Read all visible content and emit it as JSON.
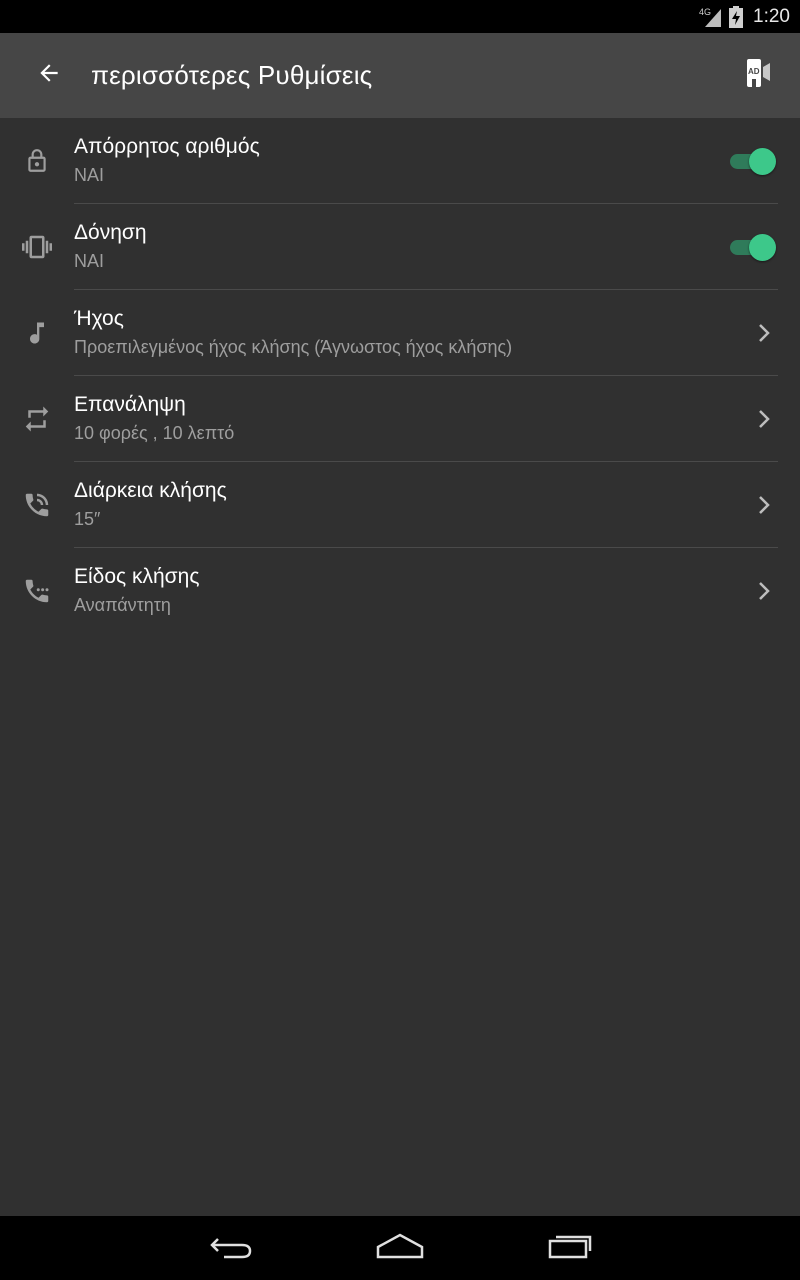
{
  "status_bar": {
    "network": "4G",
    "time": "1:20"
  },
  "app_bar": {
    "title": "περισσότερες Ρυθμίσεις",
    "back_icon": "arrow-left-icon",
    "action_icon": "ad-block-icon"
  },
  "colors": {
    "accent": "#3dc88a",
    "toggle_track": "#2f7b5a",
    "app_bar": "#464646",
    "background": "#303030"
  },
  "settings": [
    {
      "title": "Απόρρητος αριθμός",
      "subtitle": "ΝΑΙ",
      "icon": "lock-icon",
      "control": "toggle",
      "checked": true
    },
    {
      "title": "Δόνηση",
      "subtitle": "ΝΑΙ",
      "icon": "vibrate-icon",
      "control": "toggle",
      "checked": true
    },
    {
      "title": "Ήχος",
      "subtitle": "Προεπιλεγμένος ήχος κλήσης (Άγνωστος ήχος κλήσης)",
      "icon": "music-note-icon",
      "control": "chevron"
    },
    {
      "title": "Επανάληψη",
      "subtitle": "10 φορές , 10 λεπτό",
      "icon": "repeat-icon",
      "control": "chevron"
    },
    {
      "title": "Διάρκεια κλήσης",
      "subtitle": "15″",
      "icon": "phone-in-talk-icon",
      "control": "chevron"
    },
    {
      "title": "Είδος κλήσης",
      "subtitle": "Αναπάντητη",
      "icon": "phone-missed-icon",
      "control": "chevron"
    }
  ]
}
